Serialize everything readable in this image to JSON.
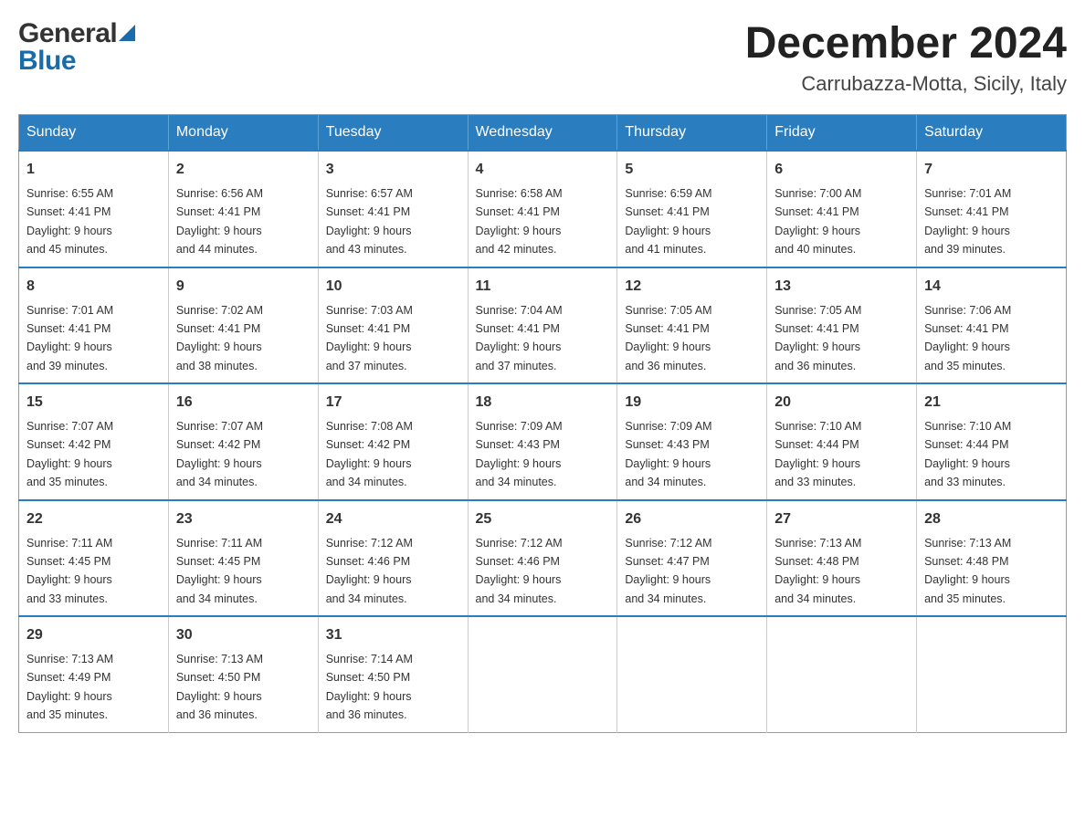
{
  "header": {
    "logo_general": "General",
    "logo_blue": "Blue",
    "month_title": "December 2024",
    "location": "Carrubazza-Motta, Sicily, Italy"
  },
  "weekdays": [
    "Sunday",
    "Monday",
    "Tuesday",
    "Wednesday",
    "Thursday",
    "Friday",
    "Saturday"
  ],
  "weeks": [
    [
      {
        "day": "1",
        "sunrise": "Sunrise: 6:55 AM",
        "sunset": "Sunset: 4:41 PM",
        "daylight": "Daylight: 9 hours",
        "daylight2": "and 45 minutes."
      },
      {
        "day": "2",
        "sunrise": "Sunrise: 6:56 AM",
        "sunset": "Sunset: 4:41 PM",
        "daylight": "Daylight: 9 hours",
        "daylight2": "and 44 minutes."
      },
      {
        "day": "3",
        "sunrise": "Sunrise: 6:57 AM",
        "sunset": "Sunset: 4:41 PM",
        "daylight": "Daylight: 9 hours",
        "daylight2": "and 43 minutes."
      },
      {
        "day": "4",
        "sunrise": "Sunrise: 6:58 AM",
        "sunset": "Sunset: 4:41 PM",
        "daylight": "Daylight: 9 hours",
        "daylight2": "and 42 minutes."
      },
      {
        "day": "5",
        "sunrise": "Sunrise: 6:59 AM",
        "sunset": "Sunset: 4:41 PM",
        "daylight": "Daylight: 9 hours",
        "daylight2": "and 41 minutes."
      },
      {
        "day": "6",
        "sunrise": "Sunrise: 7:00 AM",
        "sunset": "Sunset: 4:41 PM",
        "daylight": "Daylight: 9 hours",
        "daylight2": "and 40 minutes."
      },
      {
        "day": "7",
        "sunrise": "Sunrise: 7:01 AM",
        "sunset": "Sunset: 4:41 PM",
        "daylight": "Daylight: 9 hours",
        "daylight2": "and 39 minutes."
      }
    ],
    [
      {
        "day": "8",
        "sunrise": "Sunrise: 7:01 AM",
        "sunset": "Sunset: 4:41 PM",
        "daylight": "Daylight: 9 hours",
        "daylight2": "and 39 minutes."
      },
      {
        "day": "9",
        "sunrise": "Sunrise: 7:02 AM",
        "sunset": "Sunset: 4:41 PM",
        "daylight": "Daylight: 9 hours",
        "daylight2": "and 38 minutes."
      },
      {
        "day": "10",
        "sunrise": "Sunrise: 7:03 AM",
        "sunset": "Sunset: 4:41 PM",
        "daylight": "Daylight: 9 hours",
        "daylight2": "and 37 minutes."
      },
      {
        "day": "11",
        "sunrise": "Sunrise: 7:04 AM",
        "sunset": "Sunset: 4:41 PM",
        "daylight": "Daylight: 9 hours",
        "daylight2": "and 37 minutes."
      },
      {
        "day": "12",
        "sunrise": "Sunrise: 7:05 AM",
        "sunset": "Sunset: 4:41 PM",
        "daylight": "Daylight: 9 hours",
        "daylight2": "and 36 minutes."
      },
      {
        "day": "13",
        "sunrise": "Sunrise: 7:05 AM",
        "sunset": "Sunset: 4:41 PM",
        "daylight": "Daylight: 9 hours",
        "daylight2": "and 36 minutes."
      },
      {
        "day": "14",
        "sunrise": "Sunrise: 7:06 AM",
        "sunset": "Sunset: 4:41 PM",
        "daylight": "Daylight: 9 hours",
        "daylight2": "and 35 minutes."
      }
    ],
    [
      {
        "day": "15",
        "sunrise": "Sunrise: 7:07 AM",
        "sunset": "Sunset: 4:42 PM",
        "daylight": "Daylight: 9 hours",
        "daylight2": "and 35 minutes."
      },
      {
        "day": "16",
        "sunrise": "Sunrise: 7:07 AM",
        "sunset": "Sunset: 4:42 PM",
        "daylight": "Daylight: 9 hours",
        "daylight2": "and 34 minutes."
      },
      {
        "day": "17",
        "sunrise": "Sunrise: 7:08 AM",
        "sunset": "Sunset: 4:42 PM",
        "daylight": "Daylight: 9 hours",
        "daylight2": "and 34 minutes."
      },
      {
        "day": "18",
        "sunrise": "Sunrise: 7:09 AM",
        "sunset": "Sunset: 4:43 PM",
        "daylight": "Daylight: 9 hours",
        "daylight2": "and 34 minutes."
      },
      {
        "day": "19",
        "sunrise": "Sunrise: 7:09 AM",
        "sunset": "Sunset: 4:43 PM",
        "daylight": "Daylight: 9 hours",
        "daylight2": "and 34 minutes."
      },
      {
        "day": "20",
        "sunrise": "Sunrise: 7:10 AM",
        "sunset": "Sunset: 4:44 PM",
        "daylight": "Daylight: 9 hours",
        "daylight2": "and 33 minutes."
      },
      {
        "day": "21",
        "sunrise": "Sunrise: 7:10 AM",
        "sunset": "Sunset: 4:44 PM",
        "daylight": "Daylight: 9 hours",
        "daylight2": "and 33 minutes."
      }
    ],
    [
      {
        "day": "22",
        "sunrise": "Sunrise: 7:11 AM",
        "sunset": "Sunset: 4:45 PM",
        "daylight": "Daylight: 9 hours",
        "daylight2": "and 33 minutes."
      },
      {
        "day": "23",
        "sunrise": "Sunrise: 7:11 AM",
        "sunset": "Sunset: 4:45 PM",
        "daylight": "Daylight: 9 hours",
        "daylight2": "and 34 minutes."
      },
      {
        "day": "24",
        "sunrise": "Sunrise: 7:12 AM",
        "sunset": "Sunset: 4:46 PM",
        "daylight": "Daylight: 9 hours",
        "daylight2": "and 34 minutes."
      },
      {
        "day": "25",
        "sunrise": "Sunrise: 7:12 AM",
        "sunset": "Sunset: 4:46 PM",
        "daylight": "Daylight: 9 hours",
        "daylight2": "and 34 minutes."
      },
      {
        "day": "26",
        "sunrise": "Sunrise: 7:12 AM",
        "sunset": "Sunset: 4:47 PM",
        "daylight": "Daylight: 9 hours",
        "daylight2": "and 34 minutes."
      },
      {
        "day": "27",
        "sunrise": "Sunrise: 7:13 AM",
        "sunset": "Sunset: 4:48 PM",
        "daylight": "Daylight: 9 hours",
        "daylight2": "and 34 minutes."
      },
      {
        "day": "28",
        "sunrise": "Sunrise: 7:13 AM",
        "sunset": "Sunset: 4:48 PM",
        "daylight": "Daylight: 9 hours",
        "daylight2": "and 35 minutes."
      }
    ],
    [
      {
        "day": "29",
        "sunrise": "Sunrise: 7:13 AM",
        "sunset": "Sunset: 4:49 PM",
        "daylight": "Daylight: 9 hours",
        "daylight2": "and 35 minutes."
      },
      {
        "day": "30",
        "sunrise": "Sunrise: 7:13 AM",
        "sunset": "Sunset: 4:50 PM",
        "daylight": "Daylight: 9 hours",
        "daylight2": "and 36 minutes."
      },
      {
        "day": "31",
        "sunrise": "Sunrise: 7:14 AM",
        "sunset": "Sunset: 4:50 PM",
        "daylight": "Daylight: 9 hours",
        "daylight2": "and 36 minutes."
      },
      {
        "day": "",
        "sunrise": "",
        "sunset": "",
        "daylight": "",
        "daylight2": ""
      },
      {
        "day": "",
        "sunrise": "",
        "sunset": "",
        "daylight": "",
        "daylight2": ""
      },
      {
        "day": "",
        "sunrise": "",
        "sunset": "",
        "daylight": "",
        "daylight2": ""
      },
      {
        "day": "",
        "sunrise": "",
        "sunset": "",
        "daylight": "",
        "daylight2": ""
      }
    ]
  ]
}
